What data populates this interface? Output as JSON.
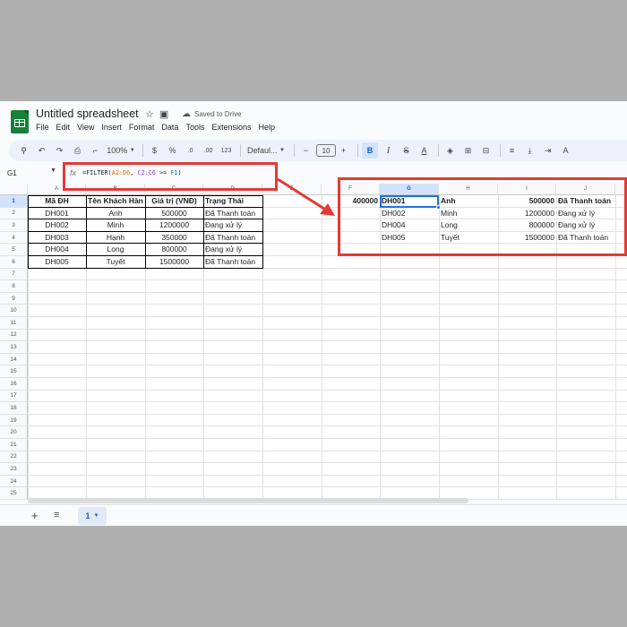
{
  "app": {
    "doc_title": "Untitled spreadsheet",
    "save_status": "Saved to Drive",
    "menu": [
      "File",
      "Edit",
      "View",
      "Insert",
      "Format",
      "Data",
      "Tools",
      "Extensions",
      "Help"
    ]
  },
  "toolbar": {
    "zoom": "100%",
    "currency": "$",
    "percent": "%",
    "dec_less": ".0",
    "dec_more": ".00",
    "num_format": "123",
    "font": "Defaul...",
    "font_size": "10",
    "bold": "B",
    "italic": "I",
    "text_color": "A"
  },
  "formula_bar": {
    "name_box": "G1",
    "fx": "fx",
    "formula_prefix": "=FILTER(",
    "range1": "A2:D6",
    "sep": ", ",
    "range2": "C2:C6",
    "op": " >= ",
    "ref": "F1",
    "formula_suffix": ")"
  },
  "grid": {
    "columns_left": [
      "A",
      "B",
      "C",
      "D",
      "E"
    ],
    "columns_right": [
      "F",
      "G",
      "H",
      "I",
      "J"
    ],
    "rows": [
      "1",
      "2",
      "3",
      "4",
      "5",
      "6",
      "7",
      "8",
      "9",
      "10",
      "11",
      "12",
      "13",
      "14",
      "15",
      "16",
      "17",
      "18",
      "19",
      "20",
      "21",
      "22",
      "23",
      "24",
      "25"
    ],
    "headers": [
      "Mã ĐH",
      "Tên Khách Hàng",
      "Giá trị (VNĐ)",
      "Trạng Thái"
    ],
    "source_rows": [
      [
        "DH001",
        "Anh",
        "500000",
        "Đã Thanh toán"
      ],
      [
        "DH002",
        "Minh",
        "1200000",
        "Đang xử lý"
      ],
      [
        "DH003",
        "Hạnh",
        "350000",
        "Đã Thanh toán"
      ],
      [
        "DH004",
        "Long",
        "800000",
        "Đang xử lý"
      ],
      [
        "DH005",
        "Tuyết",
        "1500000",
        "Đã Thanh toán"
      ]
    ],
    "f1_value": "400000",
    "result_rows": [
      [
        "DH001",
        "Anh",
        "500000",
        "Đã Thanh toán"
      ],
      [
        "DH002",
        "Minh",
        "1200000",
        "Đang xử lý"
      ],
      [
        "DH004",
        "Long",
        "800000",
        "Đang xử lý"
      ],
      [
        "DH005",
        "Tuyết",
        "1500000",
        "Đã Thanh toán"
      ]
    ]
  },
  "sheets": {
    "add": "+",
    "all": "≡",
    "active": "1"
  }
}
